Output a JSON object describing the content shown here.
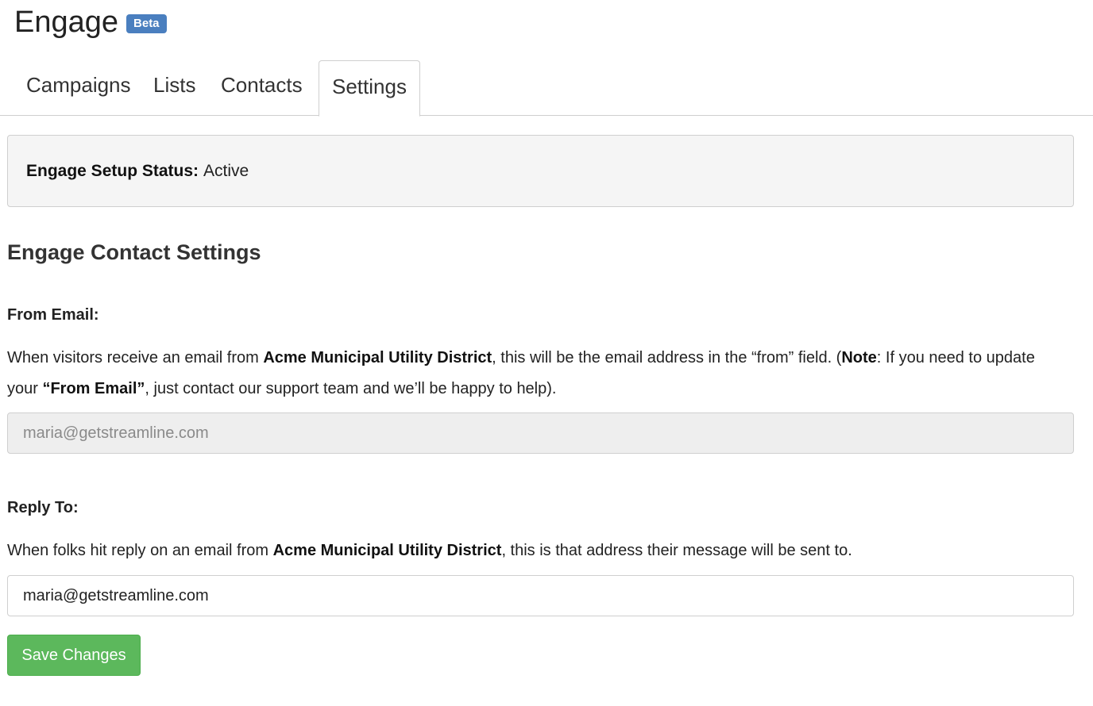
{
  "app": {
    "title": "Engage",
    "badge": "Beta"
  },
  "tabs": [
    {
      "label": "Campaigns"
    },
    {
      "label": "Lists"
    },
    {
      "label": "Contacts"
    },
    {
      "label": "Settings",
      "active": true
    }
  ],
  "status": {
    "label": "Engage Setup Status:",
    "value": "Active"
  },
  "section": {
    "title": "Engage Contact Settings"
  },
  "from_email": {
    "label": "From Email:",
    "desc_1": "When visitors receive an email from ",
    "org": "Acme Municipal Utility District",
    "desc_2": ", this will be the email address in the “from” field. (",
    "note": "Note",
    "desc_3": ": If you need to update your ",
    "field_ref": "“From Email”",
    "desc_4": ", just contact our support team and we’ll be happy to help).",
    "value": "maria@getstreamline.com"
  },
  "reply_to": {
    "label": "Reply To:",
    "desc_1": "When folks hit reply on an email from ",
    "org": "Acme Municipal Utility District",
    "desc_2": ", this is that address their message will be sent to.",
    "value": "maria@getstreamline.com"
  },
  "actions": {
    "save_label": "Save Changes"
  },
  "colors": {
    "badge": "#4a7fbf",
    "save_button": "#5cb85c"
  }
}
